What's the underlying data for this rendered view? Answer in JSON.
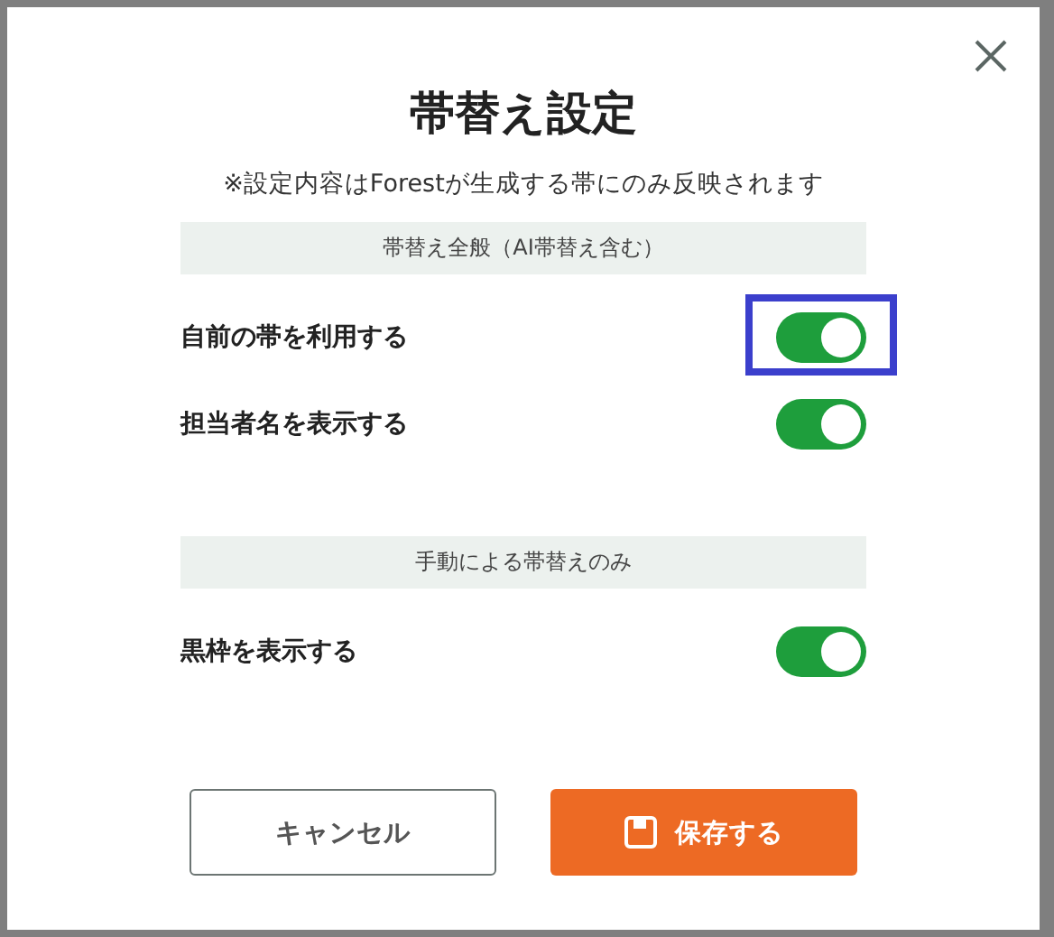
{
  "dialog": {
    "title": "帯替え設定",
    "note": "※設定内容はForestが生成する帯にのみ反映されます"
  },
  "sections": [
    {
      "header": "帯替え全般（AI帯替え含む）",
      "settings": [
        {
          "label": "自前の帯を利用する",
          "on": true,
          "focused": true
        },
        {
          "label": "担当者名を表示する",
          "on": true,
          "focused": false
        }
      ]
    },
    {
      "header": "手動による帯替えのみ",
      "settings": [
        {
          "label": "黒枠を表示する",
          "on": true,
          "focused": false
        }
      ]
    }
  ],
  "buttons": [
    {
      "kind": "secondary",
      "label": "キャンセル"
    },
    {
      "kind": "primary",
      "label": "保存する"
    }
  ]
}
